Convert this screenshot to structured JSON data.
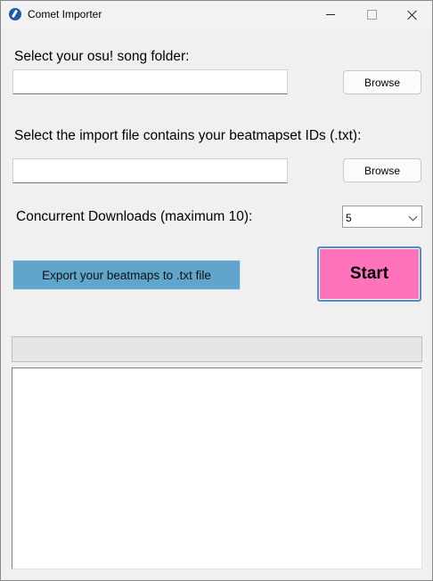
{
  "window": {
    "title": "Comet Importer"
  },
  "form": {
    "song_folder_label": "Select your osu! song folder:",
    "song_folder_value": "",
    "browse_label": "Browse",
    "import_file_label": "Select the import file contains your beatmapset IDs (.txt):",
    "import_file_value": "",
    "browse2_label": "Browse",
    "concurrent_label": "Concurrent Downloads (maximum 10):",
    "concurrent_value": "5"
  },
  "actions": {
    "export_label": "Export your beatmaps to .txt file",
    "start_label": "Start",
    "start_color": "#ff73bd",
    "export_color": "#5fa5cc"
  },
  "progress": {
    "value": 0
  },
  "log": {
    "text": ""
  }
}
